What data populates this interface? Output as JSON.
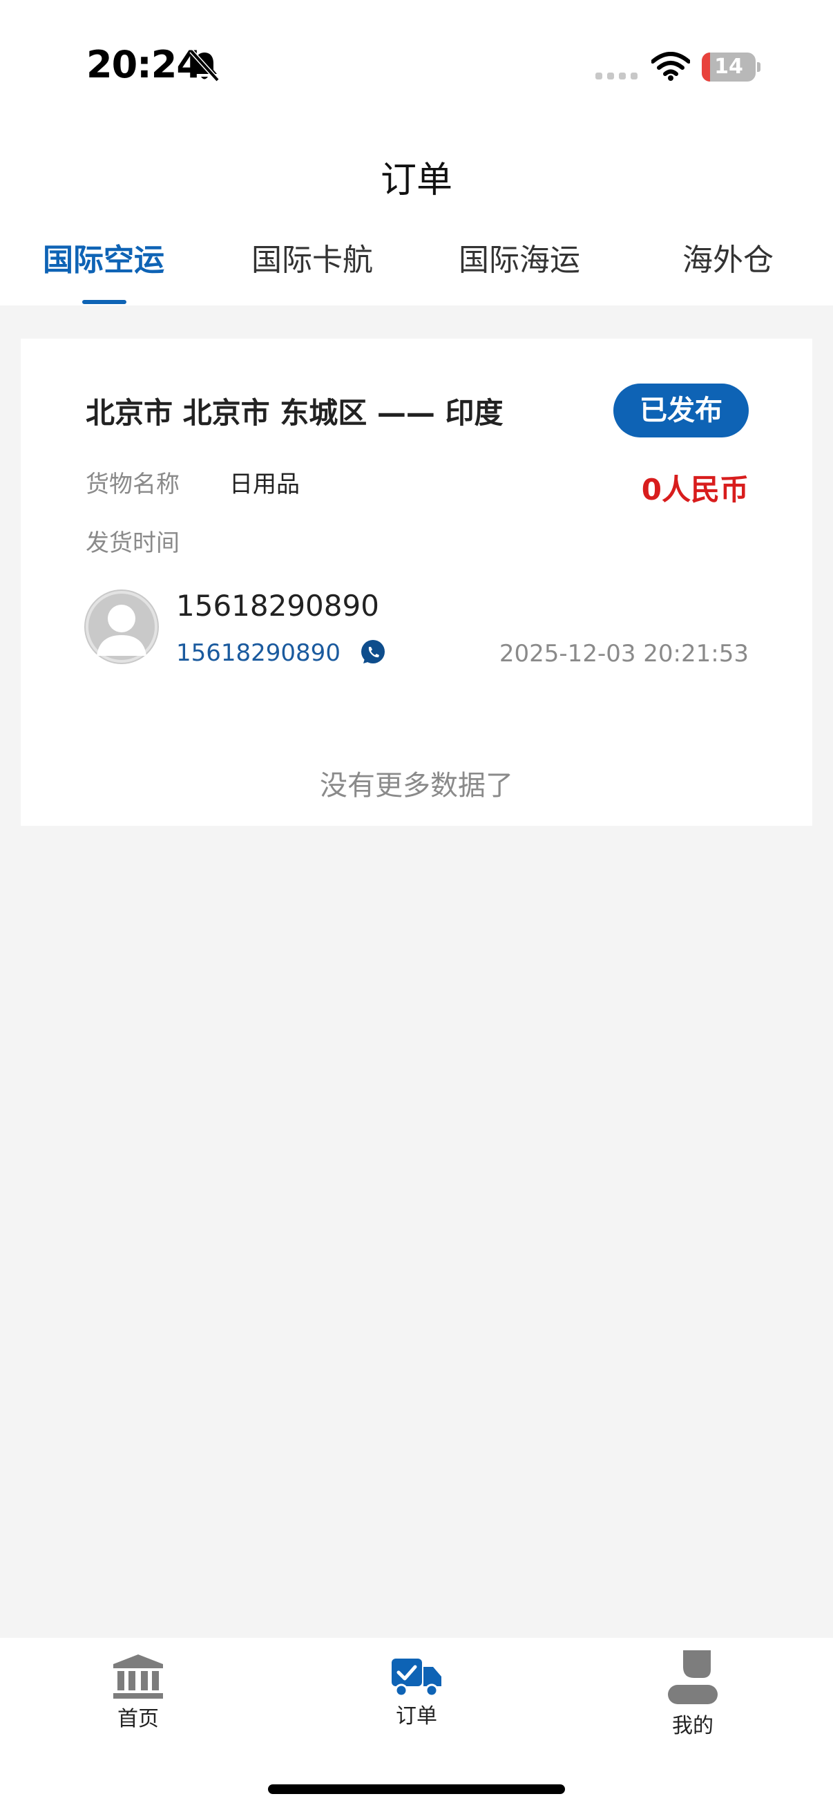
{
  "status_bar": {
    "time": "20:24",
    "battery_level": "14",
    "icons": [
      "bell-slash-icon",
      "signal-icon",
      "wifi-icon",
      "battery-icon"
    ]
  },
  "header": {
    "title": "订单"
  },
  "tabs": [
    {
      "label": "国际空运",
      "active": true
    },
    {
      "label": "国际卡航",
      "active": false
    },
    {
      "label": "国际海运",
      "active": false
    },
    {
      "label": "海外仓",
      "active": false
    }
  ],
  "order": {
    "route": "北京市 北京市 东城区 —— 印度",
    "status": "已发布",
    "goods_label": "货物名称",
    "goods_value": "日用品",
    "price": "0人民币",
    "ship_time_label": "发货时间",
    "contact_name": "15618290890",
    "contact_phone": "15618290890",
    "posted_at": "2025-12-03 20:21:53"
  },
  "list_footer": "没有更多数据了",
  "bottom_nav": [
    {
      "label": "首页",
      "icon": "bank-icon"
    },
    {
      "label": "订单",
      "icon": "truck-icon",
      "active": true
    },
    {
      "label": "我的",
      "icon": "user-icon"
    }
  ],
  "colors": {
    "accent": "#0e63b5",
    "price": "#d81d1d",
    "muted": "#8a8a8a",
    "background": "#f4f4f4"
  }
}
